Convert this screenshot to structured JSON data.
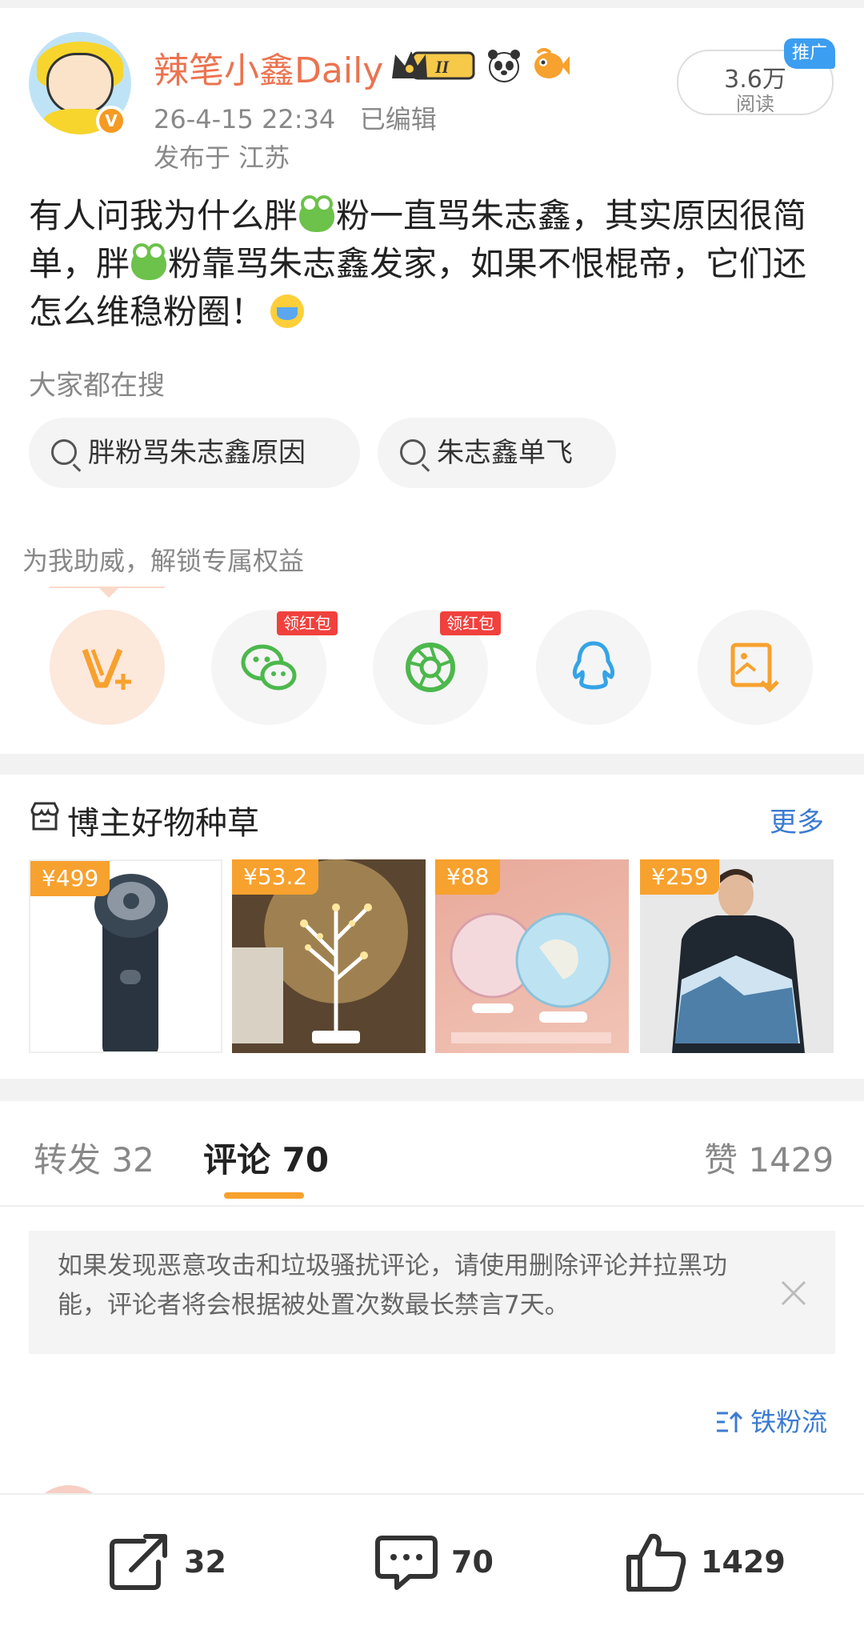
{
  "post": {
    "username": "辣笔小鑫Daily",
    "verified_badge": "V",
    "timestamp": "26-4-15 22:34",
    "edited": "已编辑",
    "location": "发布于 江苏",
    "reads": "3.6万",
    "reads_label": "阅读",
    "promo_tag": "推广",
    "text_1": "有人问我为什么胖",
    "text_2": "粉一直骂朱志鑫，其实原因很简单，胖",
    "text_3": "粉靠骂朱志鑫发家，如果不恨棍帝，它们还怎么维稳粉圈！"
  },
  "search": {
    "title": "大家都在搜",
    "chips": [
      "胖粉骂朱志鑫原因",
      "朱志鑫单飞"
    ]
  },
  "boost": {
    "title": "为我助威，解锁专属权益",
    "red_tag": "领红包",
    "icons": [
      "vip-plus-icon",
      "wechat-icon",
      "moments-icon",
      "qq-icon",
      "save-image-icon"
    ]
  },
  "goods": {
    "title": "博主好物种草",
    "more": "更多",
    "prices": [
      "¥499",
      "¥53.2",
      "¥88",
      "¥259"
    ]
  },
  "tabs": {
    "repost": "转发 32",
    "comment": "评论 70",
    "like": "赞 1429"
  },
  "notice": {
    "text": "如果发现恶意攻击和垃圾骚扰评论，请使用删除评论并拉黑功能，评论者将会根据被处置次数最长禁言7天。"
  },
  "sort": {
    "label": "铁粉流"
  },
  "bottom": {
    "repost": "32",
    "comment": "70",
    "like": "1429"
  },
  "colors": {
    "accent": "#f7a12e",
    "link": "#3b7bd1",
    "username": "#eb7350"
  }
}
